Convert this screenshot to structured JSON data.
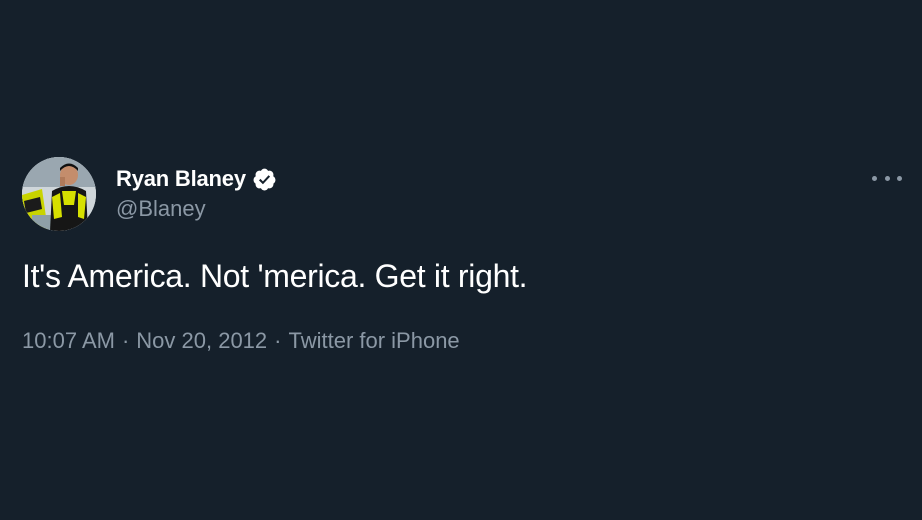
{
  "tweet": {
    "author": {
      "display_name": "Ryan Blaney",
      "handle": "@Blaney",
      "verified": true,
      "avatar": "profile-photo"
    },
    "text": "It's America. Not 'merica. Get it right.",
    "time": "10:07 AM",
    "date": "Nov 20, 2012",
    "source": "Twitter for iPhone",
    "separator": "·",
    "more_icon": "more-horizontal-icon"
  },
  "colors": {
    "background": "#15202b",
    "primary_text": "#ffffff",
    "secondary_text": "#8b98a5"
  }
}
